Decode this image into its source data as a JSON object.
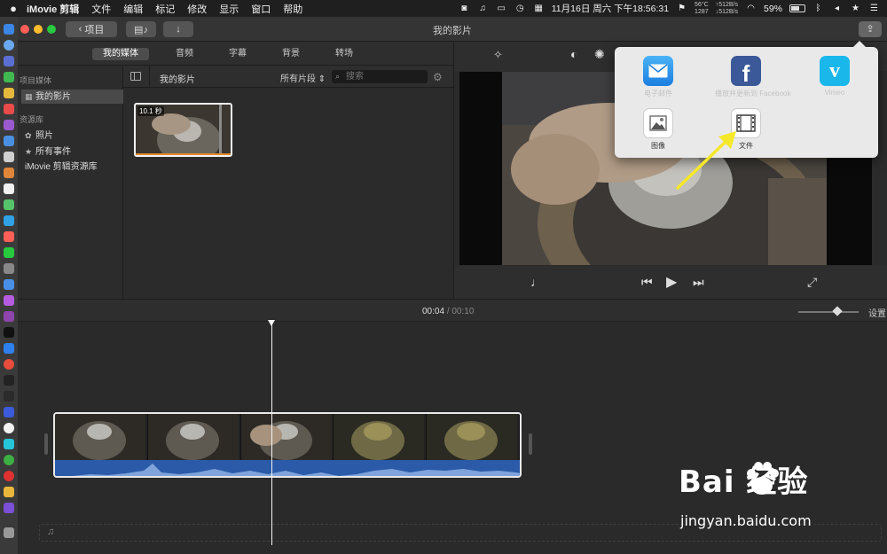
{
  "menubar": {
    "apple_symbol": "",
    "app_name": "iMovie 剪辑",
    "items": [
      "文件",
      "编辑",
      "标记",
      "修改",
      "显示",
      "窗口",
      "帮助"
    ],
    "temp1": "56°C",
    "temp2": "1287",
    "net_up": "↑512B/s",
    "net_down": "↓512B/s",
    "datetime": "11月16日 周六 下午18:56:31",
    "battery": "59%"
  },
  "toolbar": {
    "back_label": "项目",
    "window_title": "我的影片"
  },
  "media_tabs": [
    "我的媒体",
    "音频",
    "字幕",
    "背景",
    "转场"
  ],
  "sidebar": {
    "section1": "项目媒体",
    "project_item": "我的影片",
    "section2": "资源库",
    "photos": "照片",
    "all_events": "所有事件",
    "library": "iMovie 剪辑资源库"
  },
  "browser": {
    "library_name": "我的影片",
    "filter": "所有片段",
    "search_placeholder": "搜索",
    "clip_duration": "10.1 秒"
  },
  "timeline": {
    "current_time": "00:04",
    "separator": "/",
    "total_time": "00:10",
    "settings_label": "设置"
  },
  "share_popover": {
    "items": [
      {
        "label": "电子邮件",
        "icon": "mail-icon"
      },
      {
        "label": "播放并更新到 Facebook",
        "icon": "facebook-icon"
      },
      {
        "label": "Vimeo",
        "icon": "vimeo-icon"
      },
      {
        "label": "图像",
        "icon": "image-icon"
      },
      {
        "label": "文件",
        "icon": "film-file-icon"
      }
    ]
  },
  "watermark": {
    "brand": "Bai  经验",
    "url": "jingyan.baidu.com"
  },
  "colors": {
    "accent_yellow": "#f5e82a",
    "facebook_blue": "#3b5998",
    "vimeo_blue": "#1ab7ea",
    "audio_blue": "#2a5aa8"
  }
}
